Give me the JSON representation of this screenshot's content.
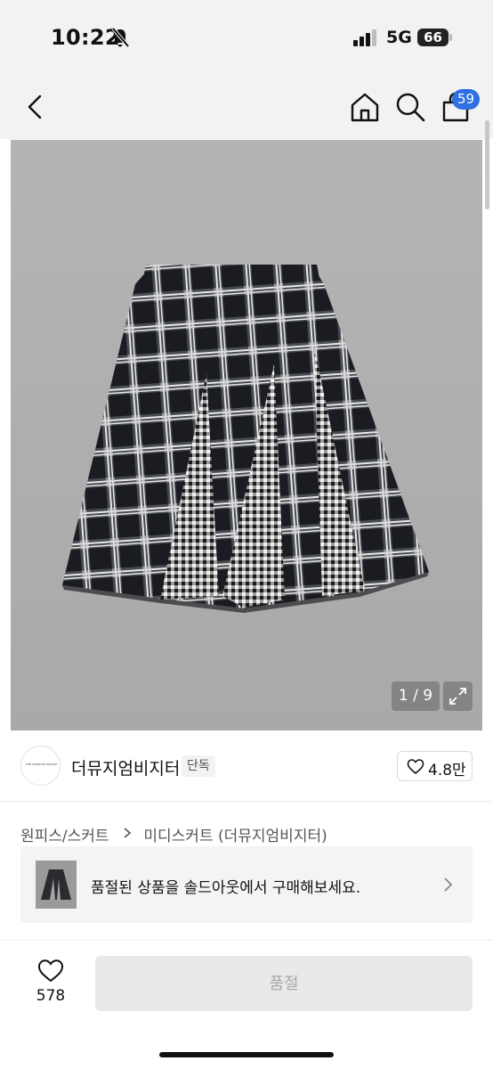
{
  "status_bar": {
    "time": "10:22",
    "network": "5G",
    "battery": "66"
  },
  "header": {
    "cart_count": "59"
  },
  "gallery": {
    "counter": "1 / 9"
  },
  "brand": {
    "logo_text": "THE MUSEUM VISITOR",
    "name": "더뮤지엄비지터",
    "tag": "단독",
    "like_count": "4.8만"
  },
  "breadcrumb": {
    "category": "원피스/스커트",
    "subcategory": "미디스커트 (더뮤지엄비지터)"
  },
  "soldout_banner": {
    "text": "품절된 상품을 솔드아웃에서 구매해보세요."
  },
  "bottom_bar": {
    "wish_count": "578",
    "buy_label": "품절"
  },
  "colors": {
    "accent": "#2f6fe4",
    "disabled_button": "#e9e9e9"
  }
}
